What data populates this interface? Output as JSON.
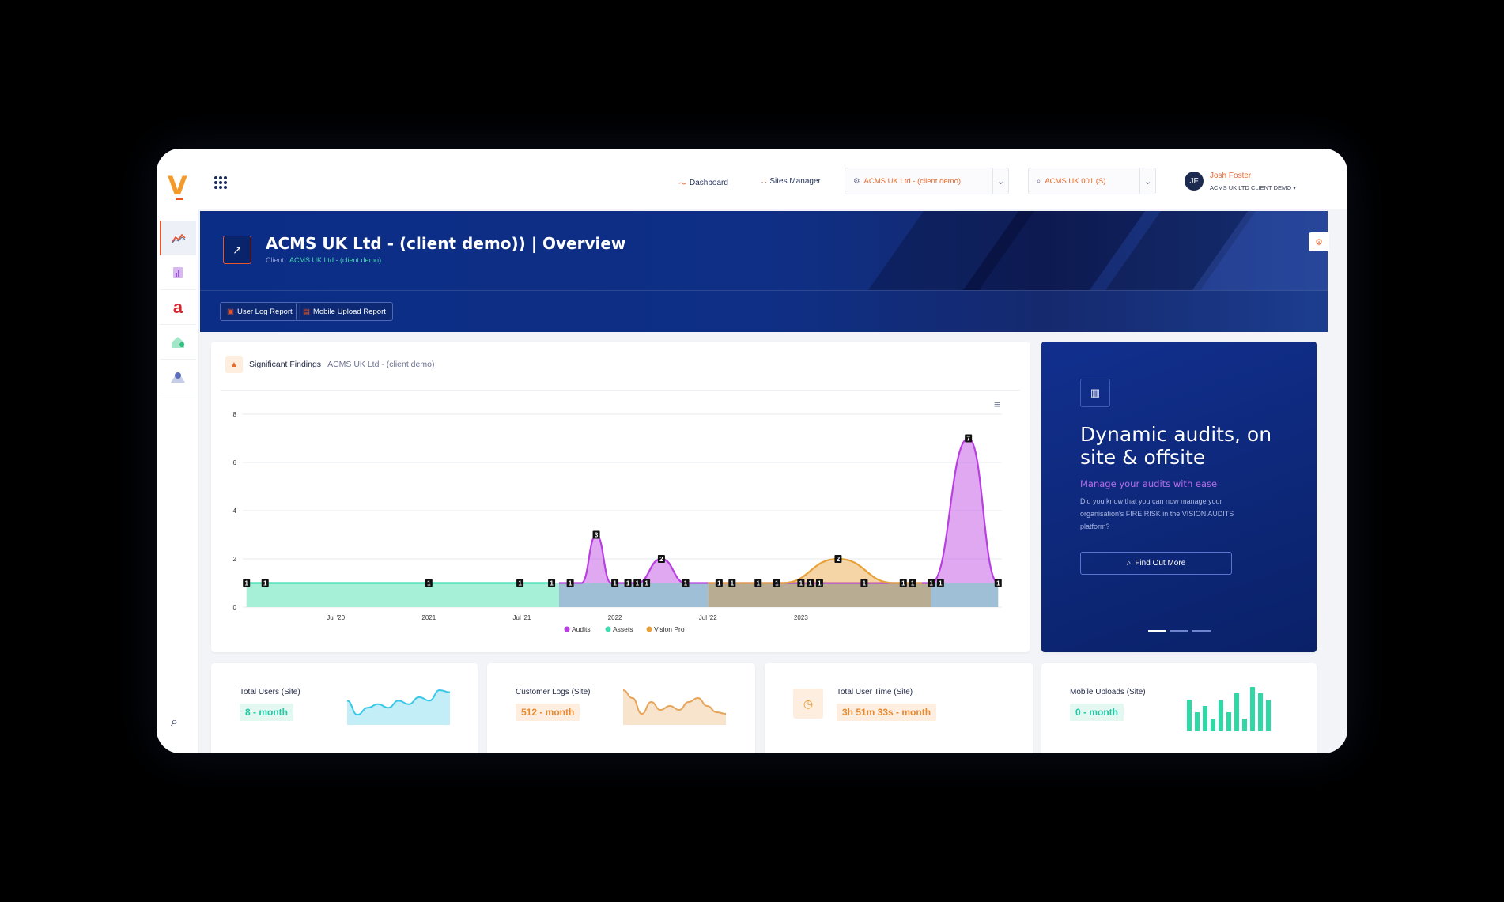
{
  "topbar": {
    "logo": "V",
    "nav": [
      {
        "label": "Dashboard",
        "icon": "chart-line-icon"
      },
      {
        "label": "Sites Manager",
        "icon": "sitemap-icon"
      }
    ],
    "client_select": "ACMS UK Ltd - (client demo)",
    "site_select": "ACMS UK 001 (S)",
    "user": {
      "initials": "JF",
      "name": "Josh Foster",
      "org": "ACMS UK LTD CLIENT DEMO"
    }
  },
  "hero": {
    "title": "ACMS UK Ltd - (client demo)) | Overview",
    "client_prefix": "Client :",
    "client_name": "ACMS UK Ltd - (client demo)",
    "buttons": [
      {
        "label": "User Log Report"
      },
      {
        "label": "Mobile Upload Report"
      }
    ]
  },
  "findings": {
    "title": "Significant Findings",
    "org": "ACMS UK Ltd - (client demo)"
  },
  "promo": {
    "title": "Dynamic audits, on site & offsite",
    "subtitle": "Manage your audits with ease",
    "text": "Did you know that you can now manage your organisation's FIRE RISK in the VISION AUDITS platform?",
    "button": "Find Out More"
  },
  "stats": [
    {
      "title": "Total Users (Site)",
      "value": "8 - month",
      "color": "#1fc9a3"
    },
    {
      "title": "Customer Logs (Site)",
      "value": "512 - month",
      "color": "#e88a2e"
    },
    {
      "title": "Total User Time (Site)",
      "value": "3h 51m 33s - month",
      "color": "#e88a2e"
    },
    {
      "title": "Mobile Uploads (Site)",
      "value": "0 - month",
      "color": "#1fc9a3"
    }
  ],
  "colors": {
    "accent": "#e8562a",
    "audits": "#b93fe0",
    "assets": "#3fdcb0",
    "vision_pro": "#e8a23a",
    "hero": "#0c2d86"
  },
  "chart_data": {
    "type": "area",
    "title": "",
    "yticks": [
      "0",
      "2",
      "4",
      "6",
      "8"
    ],
    "ylim": [
      0,
      8
    ],
    "xticks": [
      "Jul '20",
      "2021",
      "Jul '21",
      "2022",
      "Jul '22",
      "2023"
    ],
    "grid": true,
    "legend_position": "bottom",
    "series": [
      {
        "name": "Audits",
        "color": "#b93fe0",
        "points": [
          [
            0.7,
            1
          ],
          [
            0.82,
            1
          ],
          [
            0.9,
            3
          ],
          [
            0.98,
            1
          ],
          [
            1.12,
            1
          ],
          [
            1.25,
            2
          ],
          [
            1.38,
            1
          ],
          [
            2.7,
            1
          ],
          [
            2.9,
            7
          ],
          [
            3.06,
            1
          ]
        ]
      },
      {
        "name": "Assets",
        "color": "#3fdcb0",
        "points": [
          [
            -0.98,
            1
          ],
          [
            -0.88,
            1
          ],
          [
            0.0,
            1
          ],
          [
            0.49,
            1
          ],
          [
            0.66,
            1
          ]
        ]
      },
      {
        "name": "Vision Pro",
        "color": "#e8a23a",
        "points": [
          [
            1.5,
            1
          ],
          [
            1.9,
            1
          ],
          [
            2.2,
            2
          ],
          [
            2.5,
            1
          ],
          [
            2.65,
            1
          ]
        ]
      }
    ],
    "point_labels": [
      {
        "x": -0.98,
        "y": 1,
        "label": "1"
      },
      {
        "x": -0.88,
        "y": 1,
        "label": "1"
      },
      {
        "x": 0.0,
        "y": 1,
        "label": "1"
      },
      {
        "x": 0.49,
        "y": 1,
        "label": "1"
      },
      {
        "x": 0.66,
        "y": 1,
        "label": "1"
      },
      {
        "x": 0.76,
        "y": 1,
        "label": "1"
      },
      {
        "x": 0.9,
        "y": 3,
        "label": "3"
      },
      {
        "x": 1.0,
        "y": 1,
        "label": "1"
      },
      {
        "x": 1.07,
        "y": 1,
        "label": "1"
      },
      {
        "x": 1.12,
        "y": 1,
        "label": "1"
      },
      {
        "x": 1.17,
        "y": 1,
        "label": "1"
      },
      {
        "x": 1.25,
        "y": 2,
        "label": "2"
      },
      {
        "x": 1.38,
        "y": 1,
        "label": "1"
      },
      {
        "x": 1.56,
        "y": 1,
        "label": "1"
      },
      {
        "x": 1.63,
        "y": 1,
        "label": "1"
      },
      {
        "x": 1.77,
        "y": 1,
        "label": "1"
      },
      {
        "x": 1.87,
        "y": 1,
        "label": "1"
      },
      {
        "x": 2.0,
        "y": 1,
        "label": "1"
      },
      {
        "x": 2.05,
        "y": 1,
        "label": "1"
      },
      {
        "x": 2.1,
        "y": 1,
        "label": "1"
      },
      {
        "x": 2.2,
        "y": 2,
        "label": "2"
      },
      {
        "x": 2.34,
        "y": 1,
        "label": "1"
      },
      {
        "x": 2.55,
        "y": 1,
        "label": "1"
      },
      {
        "x": 2.6,
        "y": 1,
        "label": "1"
      },
      {
        "x": 2.7,
        "y": 1,
        "label": "1"
      },
      {
        "x": 2.75,
        "y": 1,
        "label": "1"
      },
      {
        "x": 2.9,
        "y": 7,
        "label": "7"
      },
      {
        "x": 3.06,
        "y": 1,
        "label": "1"
      }
    ],
    "bands": [
      {
        "from": -0.98,
        "to": 0.7,
        "series": "Assets",
        "color": "#a7f0d8"
      },
      {
        "from": 0.7,
        "to": 1.5,
        "series": "Audits",
        "color": "#9fbfd6"
      },
      {
        "from": 1.5,
        "to": 2.7,
        "series": "Vision Pro",
        "color": "#b8ad93"
      },
      {
        "from": 2.7,
        "to": 3.06,
        "series": "Audits",
        "color": "#9fbfd6"
      }
    ]
  },
  "sparklines": [
    {
      "type": "area",
      "values": [
        3,
        1,
        2,
        2.5,
        2,
        3,
        2.5,
        3.5,
        3,
        4.5,
        4.2
      ],
      "color": "#38c8e8"
    },
    {
      "type": "area",
      "values": [
        4,
        3,
        1,
        2.5,
        1.5,
        2,
        1.5,
        2.5,
        3,
        2,
        1.2,
        1
      ],
      "color": "#e8a55a"
    },
    {
      "type": "bar",
      "values": [
        5,
        3,
        4,
        2,
        5,
        3,
        6,
        2,
        7,
        6,
        5
      ],
      "color": "#2fd9a6"
    }
  ]
}
